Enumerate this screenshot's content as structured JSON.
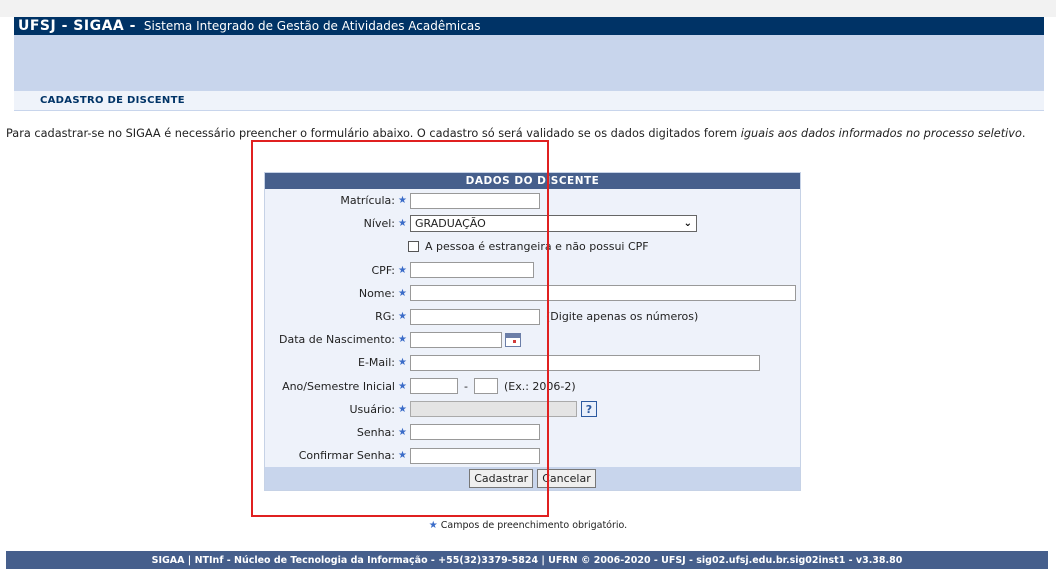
{
  "header": {
    "brand": "UFSJ - SIGAA -",
    "subtitle": "Sistema Integrado de Gestão de Atividades Acadêmicas"
  },
  "section": {
    "title": "Cadastro de Discente"
  },
  "intro": {
    "text_a": "Para cadastrar-se no SIGAA é necessário preencher o formulário abaixo. O cadastro só será validado se os dados digitados forem ",
    "text_italic": "iguais aos dados informados no processo seletivo",
    "text_b": "."
  },
  "form": {
    "caption": "Dados do Discente",
    "fields": {
      "matricula": {
        "label": "Matrícula:",
        "value": ""
      },
      "nivel": {
        "label": "Nível:",
        "value": "GRADUAÇÃO"
      },
      "estrangeira": {
        "label": "A pessoa é estrangeira e não possui CPF",
        "checked": false
      },
      "cpf": {
        "label": "CPF:",
        "value": ""
      },
      "nome": {
        "label": "Nome:",
        "value": ""
      },
      "rg": {
        "label": "RG:",
        "value": "",
        "hint": "(Digite apenas os números)"
      },
      "nascimento": {
        "label": "Data de Nascimento:",
        "value": ""
      },
      "email": {
        "label": "E-Mail:",
        "value": ""
      },
      "ano_semestre": {
        "label": "Ano/Semestre Inicial",
        "ano": "",
        "semestre": "",
        "separator": "-",
        "hint": "(Ex.: 2006-2)"
      },
      "usuario": {
        "label": "Usuário:",
        "value": ""
      },
      "senha": {
        "label": "Senha:",
        "value": ""
      },
      "confirmar_senha": {
        "label": "Confirmar Senha:",
        "value": ""
      }
    },
    "buttons": {
      "submit": "Cadastrar",
      "cancel": "Cancelar"
    }
  },
  "required_note": "Campos de preenchimento obrigatório.",
  "required_star": "★",
  "help_glyph": "?",
  "footer": "SIGAA | NTInf - Núcleo de Tecnologia da Informação - +55(32)3379-5824 | UFRN © 2006-2020 - UFSJ - sig02.ufsj.edu.br.sig02inst1 - v3.38.80",
  "colors": {
    "header": "#003366",
    "banner": "#c8d5ec",
    "caption": "#465f8c",
    "star": "#3b6cc8",
    "highlight": "#e02020"
  },
  "icons": {
    "date_picker": "calendar-icon",
    "help": "help-icon",
    "select_arrow": "chevron-down-icon"
  }
}
